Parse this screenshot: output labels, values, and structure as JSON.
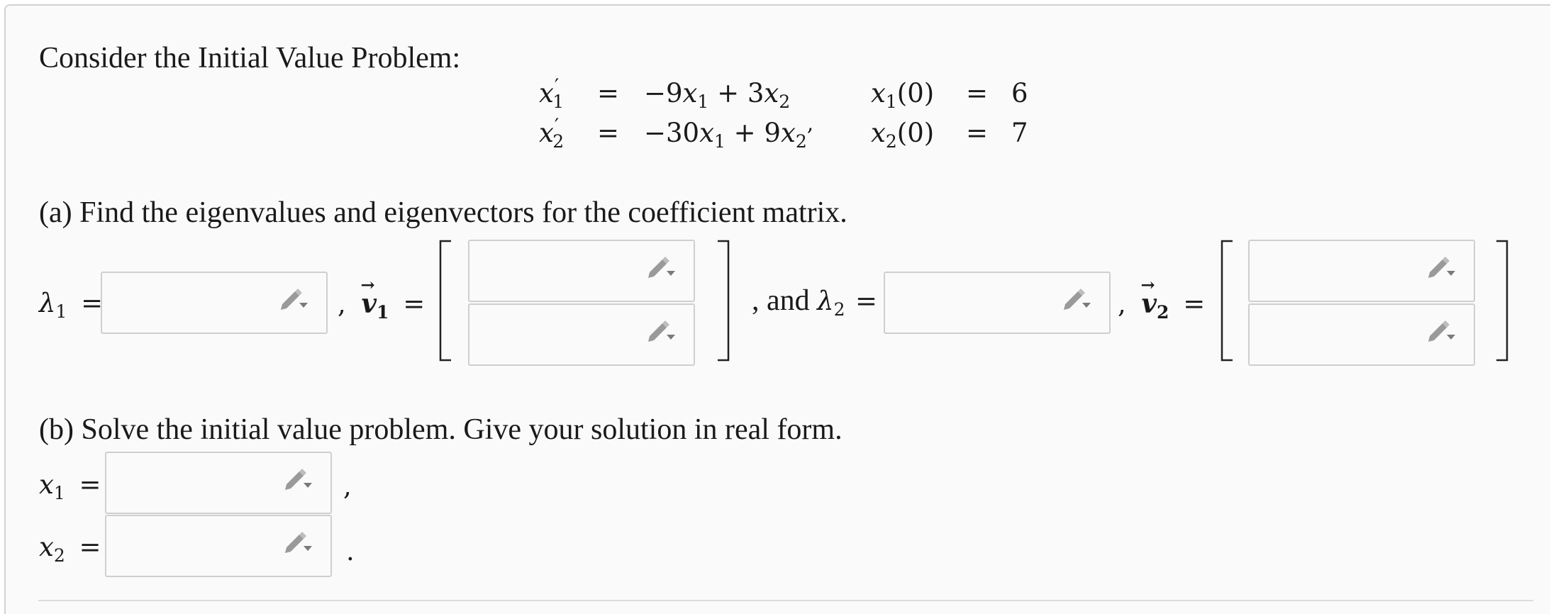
{
  "intro": "Consider the Initial Value Problem:",
  "system": {
    "row1": {
      "lhs_var": "x",
      "lhs_sub": "1",
      "prime": "′",
      "eq": "=",
      "rhs": [
        "−9",
        "x",
        "1",
        " + 3",
        "x",
        "2"
      ],
      "ic_var": "x",
      "ic_sub": "1",
      "ic_arg": "(0)",
      "ic_eq": "=",
      "ic_val": "6"
    },
    "row2": {
      "lhs_var": "x",
      "lhs_sub": "2",
      "prime": "′",
      "eq": "=",
      "rhs": [
        "−30",
        "x",
        "1",
        " + 9",
        "x",
        "2"
      ],
      "comma": ",",
      "ic_var": "x",
      "ic_sub": "2",
      "ic_arg": "(0)",
      "ic_eq": "=",
      "ic_val": "7"
    }
  },
  "part_a": {
    "prompt": "(a) Find the eigenvalues and eigenvectors for the coefficient matrix.",
    "lambda": "λ",
    "sub1": "1",
    "sub2": "2",
    "eq": "=",
    "comma": ",",
    "vec": "v",
    "and_text": ", and",
    "lambda1_value": "",
    "v1": [
      "",
      ""
    ],
    "lambda2_value": "",
    "v2": [
      "",
      ""
    ]
  },
  "part_b": {
    "prompt": "(b) Solve the initial value problem. Give your solution in real form.",
    "x": "x",
    "sub1": "1",
    "sub2": "2",
    "eq": "=",
    "comma": ",",
    "period": ".",
    "x1_value": "",
    "x2_value": ""
  },
  "icons": {
    "answer_tool": "pencil-dropdown-icon"
  },
  "colors": {
    "box_border": "#cfcfcf",
    "icon": "#9a9a9a",
    "bg": "#fafafa"
  }
}
